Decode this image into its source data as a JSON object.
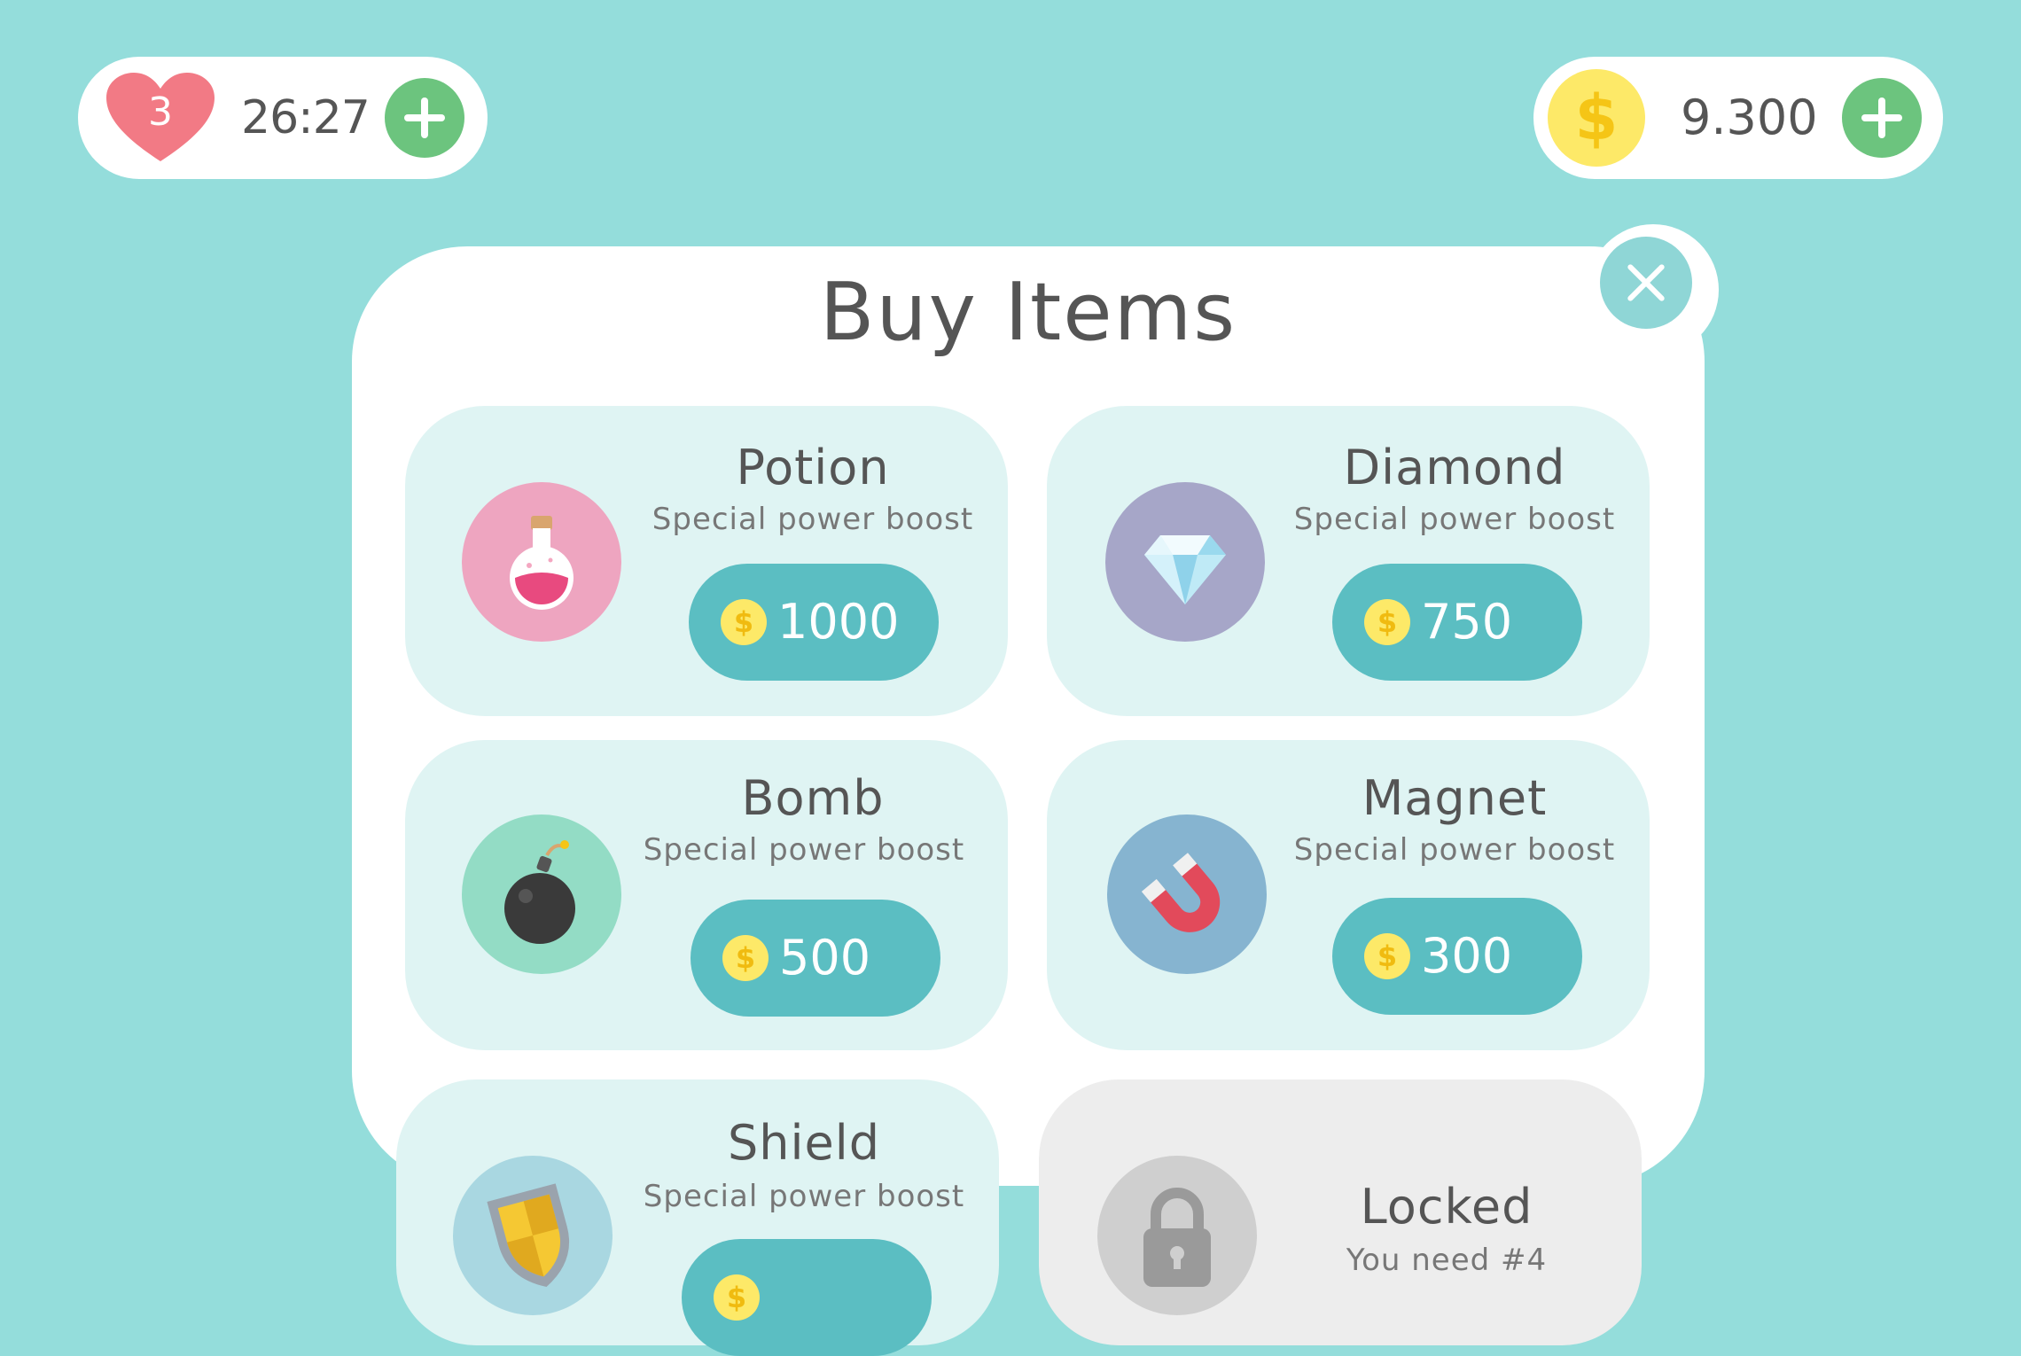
{
  "hud": {
    "lives": "3",
    "timer": "26:27",
    "coins": "9.300",
    "coin_symbol": "$"
  },
  "panel": {
    "title": "Buy Items"
  },
  "items": [
    {
      "name": "Potion",
      "desc": "Special power boost",
      "price": "1000",
      "icon": "potion-icon",
      "color": "#eea5c0"
    },
    {
      "name": "Diamond",
      "desc": "Special power boost",
      "price": "750",
      "icon": "diamond-icon",
      "color": "#a6a6c8"
    },
    {
      "name": "Bomb",
      "desc": "Special power boost",
      "price": "500",
      "icon": "bomb-icon",
      "color": "#93dcc5"
    },
    {
      "name": "Magnet",
      "desc": "Special power boost",
      "price": "300",
      "icon": "magnet-icon",
      "color": "#86b4d0"
    },
    {
      "name": "Shield",
      "desc": "Special power boost",
      "price": "",
      "icon": "shield-icon",
      "color": "#a9d7e1"
    },
    {
      "name": "Locked",
      "desc": "You need #4",
      "icon": "lock-icon",
      "color": "#cfcfcf"
    }
  ],
  "colors": {
    "background": "#94dddb",
    "card": "#dff4f3",
    "button": "#5bbec2",
    "plus": "#6cc47e",
    "heart": "#f27a85",
    "coin": "#fde968"
  }
}
